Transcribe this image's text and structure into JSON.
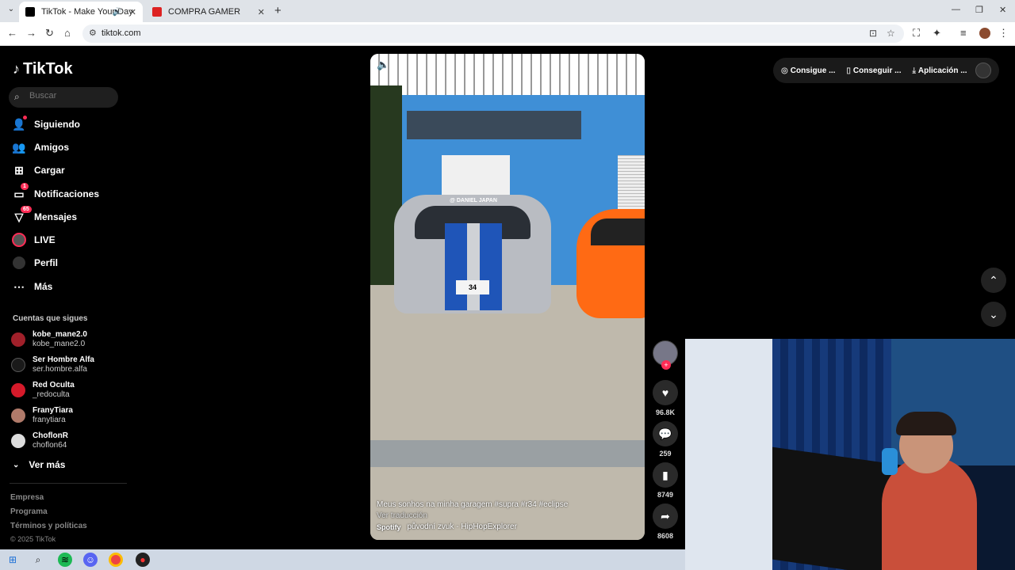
{
  "browser": {
    "tabs": [
      {
        "title": "TikTok - Make Your Day",
        "active": true
      },
      {
        "title": "COMPRA GAMER",
        "active": false
      }
    ],
    "url": "tiktok.com"
  },
  "sidebar": {
    "logo": "TikTok",
    "search_placeholder": "Buscar",
    "nav": [
      {
        "label": "Siguiendo"
      },
      {
        "label": "Amigos"
      },
      {
        "label": "Cargar"
      },
      {
        "label": "Notificaciones",
        "badge": "1"
      },
      {
        "label": "Mensajes",
        "badge": "65"
      },
      {
        "label": "LIVE"
      },
      {
        "label": "Perfil"
      },
      {
        "label": "Más"
      }
    ],
    "following_title": "Cuentas que sigues",
    "following": [
      {
        "name": "kobe_mane2.0",
        "handle": "kobe_mane2.0"
      },
      {
        "name": "Ser Hombre Alfa",
        "handle": "ser.hombre.alfa"
      },
      {
        "name": "Red Oculta",
        "handle": "_redoculta"
      },
      {
        "name": "FranyTiara",
        "handle": "franytiara"
      },
      {
        "name": "ChoflonR",
        "handle": "choflon64"
      }
    ],
    "see_more": "Ver más",
    "footer": [
      "Empresa",
      "Programa",
      "Términos y políticas"
    ],
    "copyright": "© 2025 TikTok"
  },
  "topbar": {
    "items": [
      "Consigue ...",
      "Conseguir ...",
      "Aplicación ..."
    ]
  },
  "video": {
    "caption": "Meus sonhos na minha garagem #supra #r34 #eclipse",
    "translate": "Ver traducción",
    "music_source": "Spotify",
    "music": "původní zvuk - HipHopExplorer",
    "banner": "@ DANIEL JAPAN",
    "plate": "34"
  },
  "actions": {
    "likes": "96.8K",
    "comments": "259",
    "saves": "8749",
    "shares": "8608"
  }
}
